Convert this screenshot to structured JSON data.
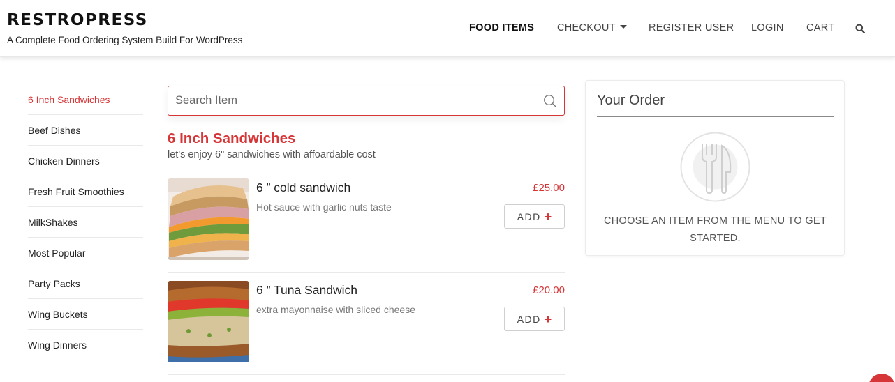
{
  "brand": {
    "title": "RESTROPRESS",
    "tagline": "A Complete Food Ordering System Build For WordPress"
  },
  "nav": {
    "items": [
      {
        "label": "FOOD ITEMS",
        "active": true
      },
      {
        "label": "CHECKOUT",
        "dropdown": true
      },
      {
        "label": "REGISTER USER"
      },
      {
        "label": "LOGIN"
      },
      {
        "label": "CART"
      }
    ],
    "search_icon": "search-icon"
  },
  "categories": {
    "items": [
      {
        "label": "6 Inch Sandwiches",
        "active": true
      },
      {
        "label": "Beef Dishes"
      },
      {
        "label": "Chicken Dinners"
      },
      {
        "label": "Fresh Fruit Smoothies"
      },
      {
        "label": "MilkShakes"
      },
      {
        "label": "Most Popular"
      },
      {
        "label": "Party Packs"
      },
      {
        "label": "Wing Buckets"
      },
      {
        "label": "Wing Dinners"
      }
    ]
  },
  "search": {
    "placeholder": "Search Item",
    "value": ""
  },
  "section": {
    "title": "6 Inch Sandwiches",
    "description": "let's enjoy 6\" sandwiches with affoardable cost"
  },
  "products": [
    {
      "name": "6 ” cold sandwich",
      "description": "Hot sauce with garlic nuts taste",
      "price": "£25.00",
      "add_label": "ADD"
    },
    {
      "name": "6 ” Tuna Sandwich",
      "description": "extra mayonnaise with sliced cheese",
      "price": "£20.00",
      "add_label": "ADD"
    }
  ],
  "order": {
    "title": "Your Order",
    "empty_message": "CHOOSE AN ITEM FROM THE MENU TO GET STARTED.",
    "icon": "fork-knife-icon"
  },
  "colors": {
    "accent": "#d63638",
    "text": "#222222",
    "muted": "#777777",
    "border": "#e9e9e9"
  }
}
